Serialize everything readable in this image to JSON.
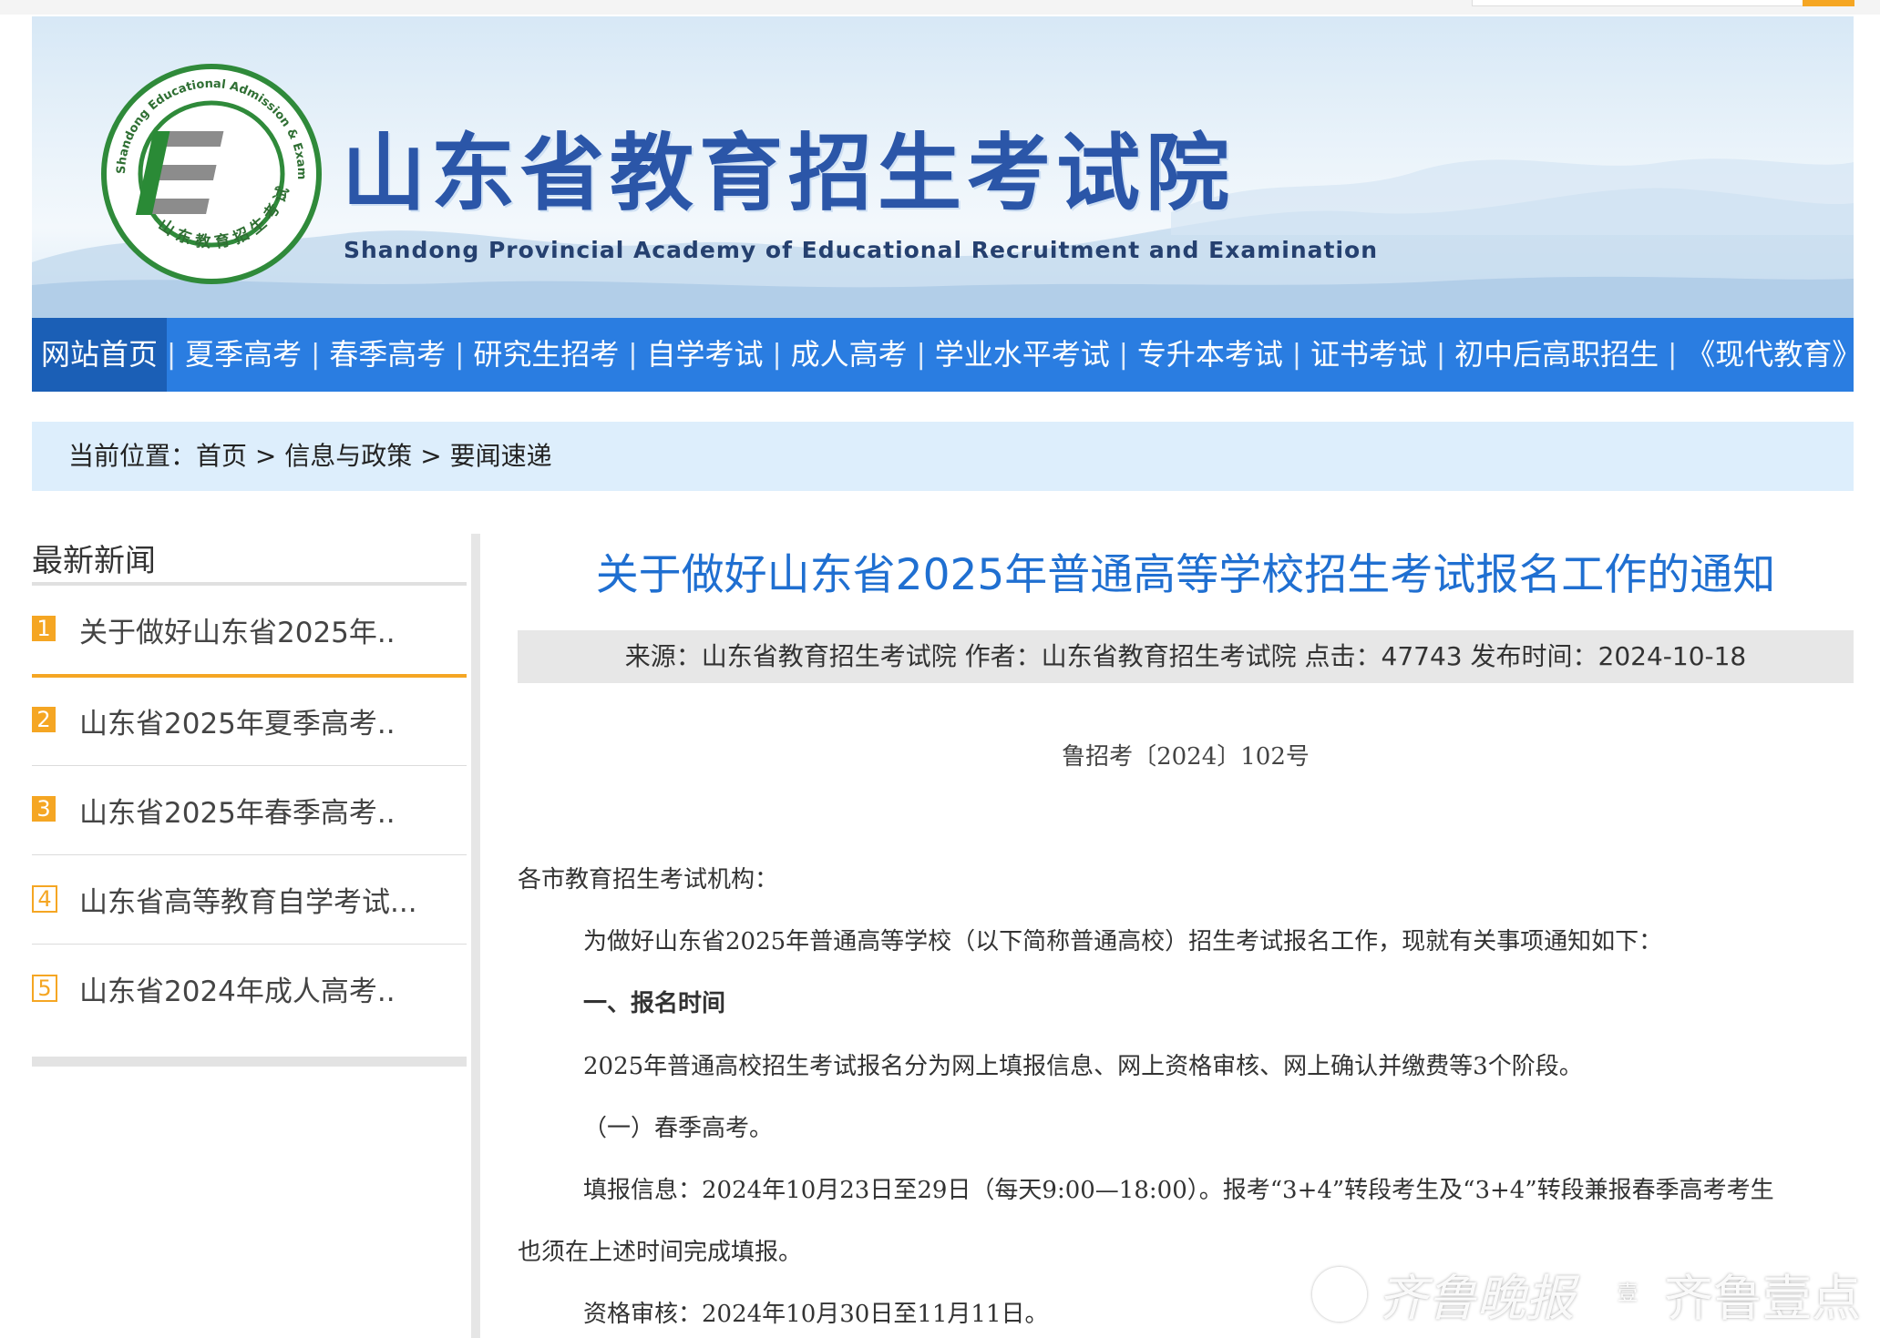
{
  "banner": {
    "title": "山东省教育招生考试院",
    "subtitle": "Shandong Provincial Academy of Educational Recruitment and Examination",
    "seal_outer_text": "Shandong Educational Admission & Examinations",
    "seal_inner_text": "山东教育招生考试"
  },
  "nav": {
    "items": [
      {
        "label": "网站首页",
        "active": true
      },
      {
        "label": "夏季高考"
      },
      {
        "label": "春季高考"
      },
      {
        "label": "研究生招考"
      },
      {
        "label": "自学考试"
      },
      {
        "label": "成人高考"
      },
      {
        "label": "学业水平考试"
      },
      {
        "label": "专升本考试"
      },
      {
        "label": "证书考试"
      },
      {
        "label": "初中后高职招生"
      },
      {
        "label": "《现代教育》"
      }
    ]
  },
  "breadcrumb": {
    "prefix": "当前位置：",
    "home": "首页",
    "sep1": " > ",
    "section": "信息与政策",
    "sep2": " > ",
    "current": "要闻速递"
  },
  "sidebar": {
    "title": "最新新闻",
    "items": [
      {
        "num": "1",
        "text": "关于做好山东省2025年.."
      },
      {
        "num": "2",
        "text": "山东省2025年夏季高考.."
      },
      {
        "num": "3",
        "text": "山东省2025年春季高考.."
      },
      {
        "num": "4",
        "text": "山东省高等教育自学考试..."
      },
      {
        "num": "5",
        "text": "山东省2024年成人高考.."
      }
    ]
  },
  "article": {
    "title": "关于做好山东省2025年普通高等学校招生考试报名工作的通知",
    "meta": "来源：山东省教育招生考试院 作者：山东省教育招生考试院 点击：47743 发布时间：2024-10-18",
    "doc_no": "鲁招考〔2024〕102号",
    "p_salutation": "各市教育招生考试机构：",
    "p_intro": "为做好山东省2025年普通高等学校（以下简称普通高校）招生考试报名工作，现就有关事项通知如下：",
    "p_heading1": "一、报名时间",
    "p_stages": "2025年普通高校招生考试报名分为网上填报信息、网上资格审核、网上确认并缴费等3个阶段。",
    "p_sub1": "（一）春季高考。",
    "p_fill_1": "填报信息：2024年10月23日至29日（每天9:00—18:00）。报考“3+4”转段考生及“3+4”转段兼报春季高考考生",
    "p_fill_2": "也须在上述时间完成填报。",
    "p_review": "资格审核：2024年10月30日至11月11日。"
  },
  "watermark": {
    "left": "齐鲁晚报",
    "box": "壹",
    "right": "齐鲁壹点"
  },
  "colors": {
    "nav_bg": "#2a7de1",
    "nav_active": "#1b5fb6",
    "title_blue": "#1f6fd1",
    "accent_orange": "#f5a623",
    "crumb_bg": "#ddeefc"
  }
}
